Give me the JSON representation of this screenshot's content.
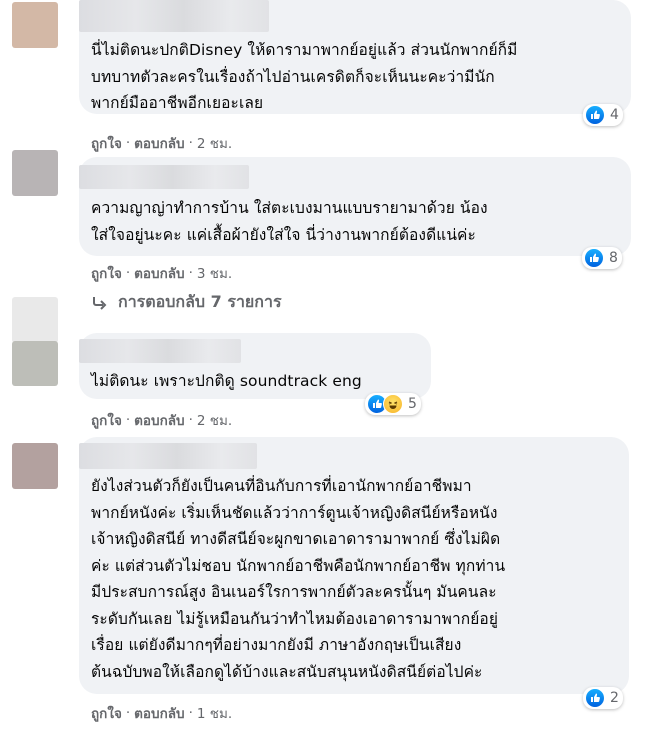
{
  "comments": [
    {
      "text": "นี่ไม่ติดนะปกติDisney ให้ดารามาพากย์อยู่แล้ว ส่วนนักพากย์ก็มี\nบทบาทตัวละครในเรื่องถ้าไปอ่านเครดิตก็จะเห็นนะคะว่ามีนัก\nพากย์มืออาชีพอีกเยอะเลย",
      "reaction_count": "4",
      "like_label": "ถูกใจ",
      "reply_label": "ตอบกลับ",
      "time": "2 ชม."
    },
    {
      "text": "ความญาญ่าทำการบ้าน ใส่ตะเบงมานแบบรายามาด้วย น้อง\nใส่ใจอยู่นะคะ แค่เสื้อผ้ายังใส่ใจ นี่ว่างานพากย์ต้องดีแน่ค่ะ",
      "reaction_count": "8",
      "like_label": "ถูกใจ",
      "reply_label": "ตอบกลับ",
      "time": "3 ชม."
    },
    {
      "text": "ไม่ติดนะ เพราะปกติดู soundtrack eng",
      "reaction_count": "5",
      "like_label": "ถูกใจ",
      "reply_label": "ตอบกลับ",
      "time": "2 ชม."
    },
    {
      "text": "ยังไงส่วนตัวก็ยังเป็นคนที่อินกับการที่เอานักพากย์อาชีพมา\nพากย์หนังค่ะ เริ่มเห็นชัดแล้วว่าการ์ตูนเจ้าหญิงดิสนีย์หรือหนัง\nเจ้าหญิงดิสนีย์ ทางดีสนีย์จะผูกขาดเอาดารามาพากย์ ซึ่งไม่ผิด\nค่ะ แต่ส่วนตัวไม่ชอบ นักพากย์อาชีพคือนักพากย์อาชีพ ทุกท่าน\nมีประสบการณ์สูง อินเนอร์ใรการพากย์ตัวละครนั้นๆ มันคนละ\nระดับกันเลย ไม่รู้เหมือนกันว่าทำไหมต้องเอาดารามาพากย์อยู่\nเรื่อย แต่ยังดีมากๆที่อย่างมากยังมี ภาษาอังกฤษเป็นเสียง\nต้นฉบับพอให้เลือกดูได้บ้างและสนับสนุนหนังดิสนีย์ต่อไปค่ะ",
      "reaction_count": "2",
      "like_label": "ถูกใจ",
      "reply_label": "ตอบกลับ",
      "time": "1 ชม."
    }
  ],
  "view_replies": "การตอบกลับ 7 รายการ",
  "colors": {
    "bubble": "#f0f2f5",
    "meta_text": "#65676b",
    "like_blue": "#0a7cff"
  }
}
